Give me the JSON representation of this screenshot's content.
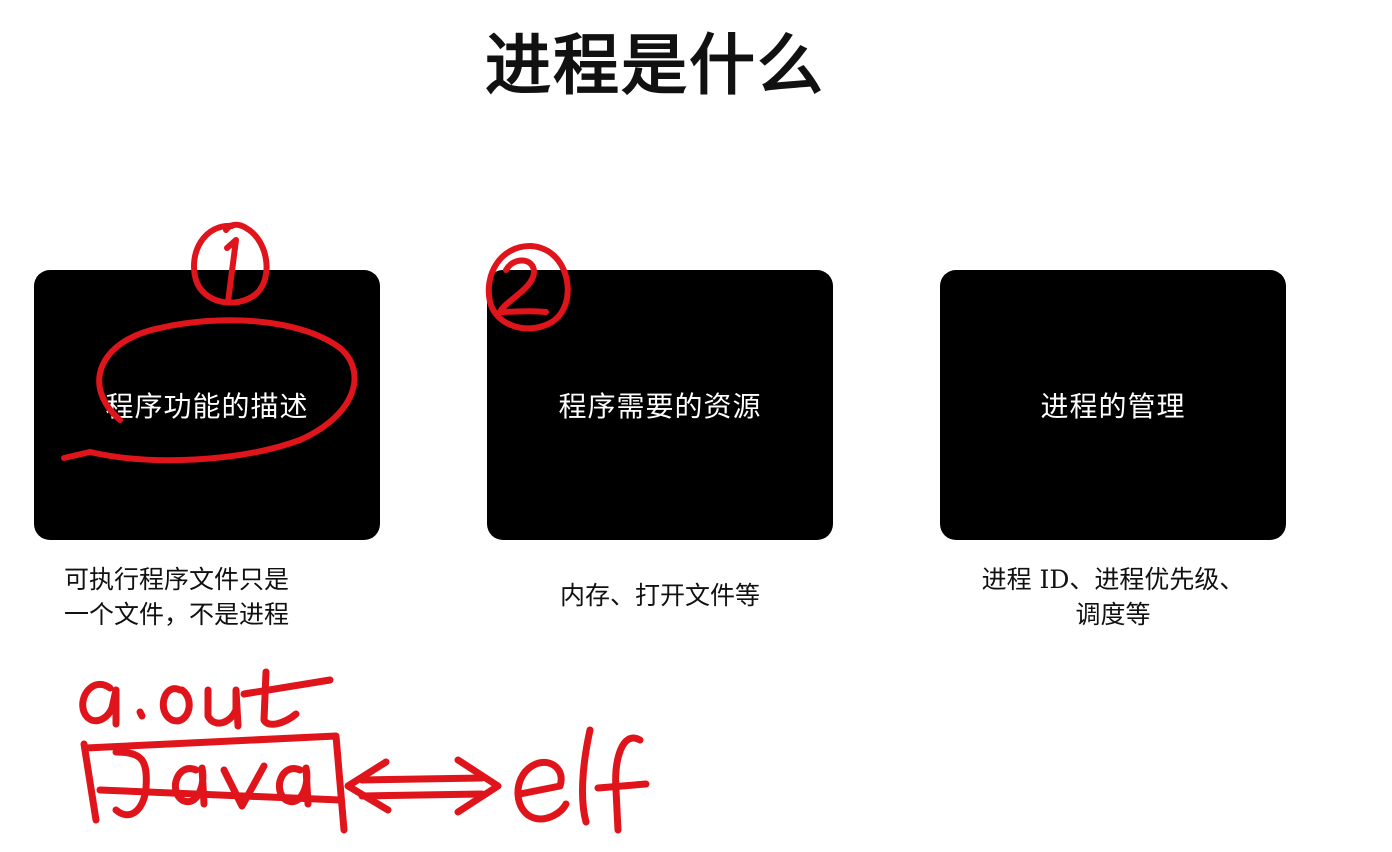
{
  "slide": {
    "title": "进程是什么",
    "cards": [
      {
        "label": "程序功能的描述",
        "caption_lines": [
          "可执行程序文件只是",
          "一个文件，不是进程"
        ]
      },
      {
        "label": "程序需要的资源",
        "caption_lines": [
          "内存、打开文件等"
        ]
      },
      {
        "label": "进程的管理",
        "caption_lines": [
          "进程 ID、进程优先级、",
          "调度等"
        ]
      }
    ]
  },
  "annotations": {
    "ink_color": "#e0141b",
    "handwritten_text": [
      "①",
      "②",
      "a.out",
      "Java",
      "⟺",
      "elf"
    ]
  }
}
